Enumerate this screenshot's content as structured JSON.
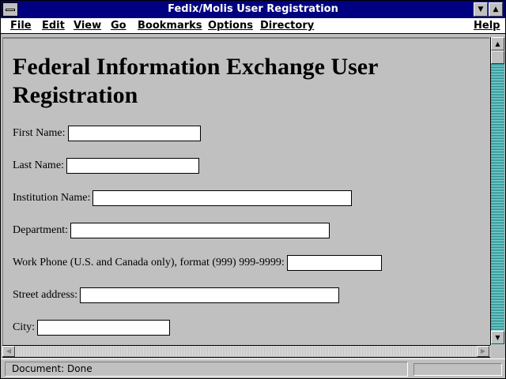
{
  "window": {
    "title": "Fedix/Molis User Registration"
  },
  "menu": {
    "file": "File",
    "edit": "Edit",
    "view": "View",
    "go": "Go",
    "bookmarks": "Bookmarks",
    "options": "Options",
    "directory": "Directory",
    "help": "Help"
  },
  "page": {
    "heading": "Federal Information Exchange User Registration",
    "fields": [
      {
        "label": "First Name:",
        "value": ""
      },
      {
        "label": "Last Name:",
        "value": ""
      },
      {
        "label": "Institution Name:",
        "value": ""
      },
      {
        "label": "Department:",
        "value": ""
      },
      {
        "label": "Work Phone (U.S. and Canada only), format (999) 999-9999:",
        "value": ""
      },
      {
        "label": "Street address:",
        "value": ""
      },
      {
        "label": "City:",
        "value": ""
      }
    ]
  },
  "status": {
    "text": "Document: Done"
  },
  "colors": {
    "titlebar": "#000080",
    "background": "#c0c0c0",
    "scrollbar_track": "#008080"
  }
}
